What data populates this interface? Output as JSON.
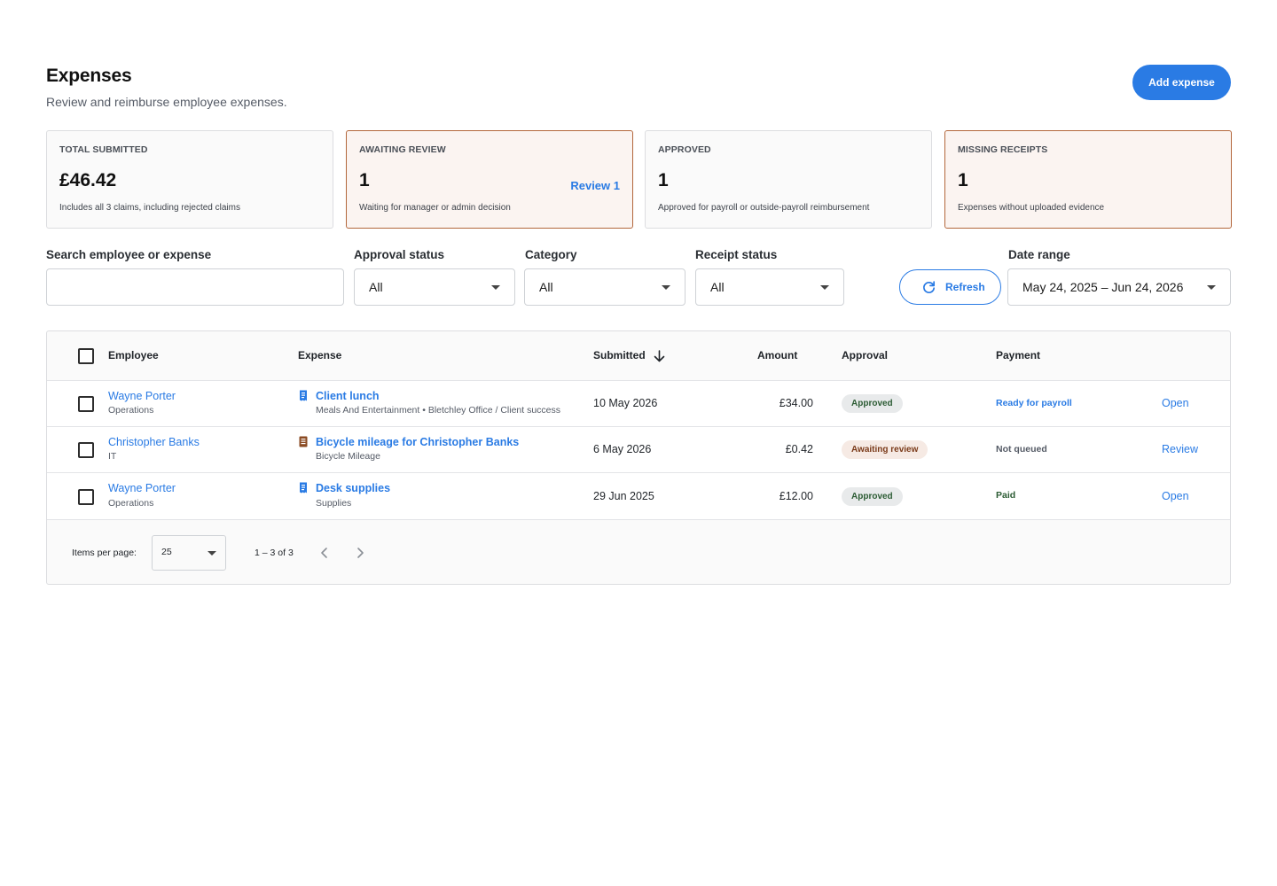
{
  "header": {
    "title": "Expenses",
    "subtitle": "Review and reimburse employee expenses.",
    "add_button": "Add expense"
  },
  "cards": [
    {
      "label": "Total submitted",
      "value": "£46.42",
      "note": "Includes all 3 claims, including rejected claims",
      "link": ""
    },
    {
      "label": "Awaiting review",
      "value": "1",
      "note": "Waiting for manager or admin decision",
      "link": "Review 1"
    },
    {
      "label": "Approved",
      "value": "1",
      "note": "Approved for payroll or outside-payroll reimbursement",
      "link": ""
    },
    {
      "label": "Missing receipts",
      "value": "1",
      "note": "Expenses without uploaded evidence",
      "link": ""
    }
  ],
  "filters": {
    "search_label": "Search employee or expense",
    "search_value": "",
    "approval_label": "Approval status",
    "approval_value": "All",
    "category_label": "Category",
    "category_value": "All",
    "receipt_label": "Receipt status",
    "receipt_value": "All",
    "refresh_label": "Refresh",
    "date_label": "Date range",
    "date_value": "May 24, 2025 – Jun 24, 2026"
  },
  "table": {
    "columns": {
      "employee": "Employee",
      "expense": "Expense",
      "submitted": "Submitted",
      "amount": "Amount",
      "approval": "Approval",
      "payment": "Payment"
    },
    "rows": [
      {
        "employee": "Wayne Porter",
        "department": "Operations",
        "expense": "Client lunch",
        "expense_detail": "Meals And Entertainment • Bletchley Office / Client success",
        "submitted": "10 May 2026",
        "amount": "£34.00",
        "approval": "Approved",
        "payment": "Ready for payroll",
        "action": "Open"
      },
      {
        "employee": "Christopher Banks",
        "department": "IT",
        "expense": "Bicycle mileage for Christopher Banks",
        "expense_detail": "Bicycle Mileage",
        "submitted": "6 May 2026",
        "amount": "£0.42",
        "approval": "Awaiting review",
        "payment": "Not queued",
        "action": "Review"
      },
      {
        "employee": "Wayne Porter",
        "department": "Operations",
        "expense": "Desk supplies",
        "expense_detail": "Supplies",
        "submitted": "29 Jun 2025",
        "amount": "£12.00",
        "approval": "Approved",
        "payment": "Paid",
        "action": "Open"
      }
    ]
  },
  "pager": {
    "items_label": "Items per page:",
    "page_size": "25",
    "range": "1 – 3 of 3"
  },
  "colors": {
    "accent": "#2a7be4",
    "alert_border": "#b3673c",
    "approved_text": "#2c5c34",
    "awaiting_text": "#7a3a19",
    "receipt_icon": "#2a7be4",
    "mileage_icon": "#8a4a22",
    "payment_ready": "#2a7be4",
    "payment_not_queued": "#555b66",
    "payment_paid": "#2c5c34"
  },
  "icons": {
    "expense_row_0": "receipt-icon",
    "expense_row_1": "mileage-log-icon",
    "expense_row_2": "receipt-icon",
    "refresh": "refresh-icon",
    "sort": "arrow-down-icon",
    "prev": "chevron-left-icon",
    "next": "chevron-right-icon"
  }
}
